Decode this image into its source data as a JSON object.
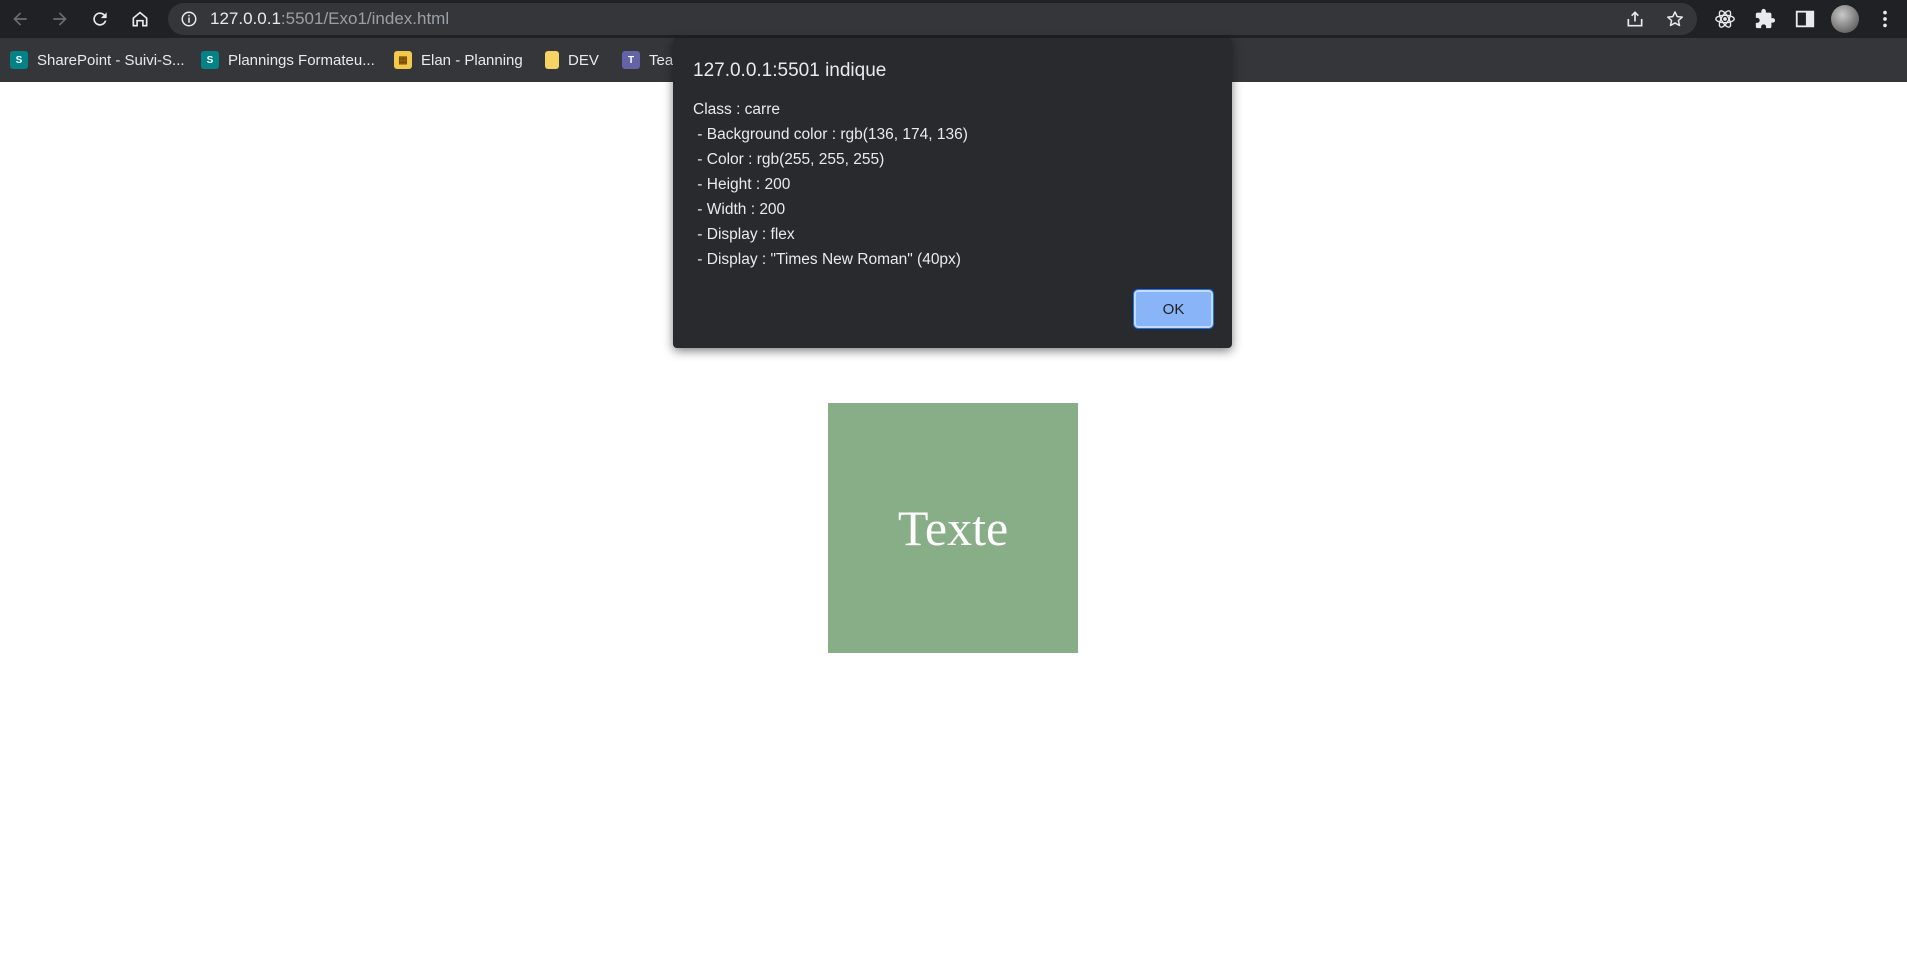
{
  "browser": {
    "url_host": "127.0.0.1",
    "url_rest": ":5501/Exo1/index.html"
  },
  "bookmarks": [
    {
      "label": "SharePoint - Suivi-S...",
      "icon": "sharepoint-icon",
      "color": "#038387"
    },
    {
      "label": "Plannings Formateu...",
      "icon": "sharepoint-icon",
      "color": "#038387"
    },
    {
      "label": "Elan - Planning",
      "icon": "planning-icon",
      "color": "#f2c94c"
    },
    {
      "label": "DEV",
      "icon": "folder-icon",
      "color": "#f6d365"
    },
    {
      "label": "Tea",
      "icon": "teams-icon",
      "color": "#6264a7"
    }
  ],
  "page": {
    "square_text": "Texte",
    "square_color": "rgb(136, 174, 136)"
  },
  "dialog": {
    "title": "127.0.0.1:5501 indique",
    "lines": [
      "Class : carre",
      " - Background color : rgb(136, 174, 136)",
      " - Color : rgb(255, 255, 255)",
      " - Height : 200",
      " - Width : 200",
      " - Display : flex",
      " - Display : \"Times New Roman\" (40px)"
    ],
    "ok_label": "OK"
  }
}
